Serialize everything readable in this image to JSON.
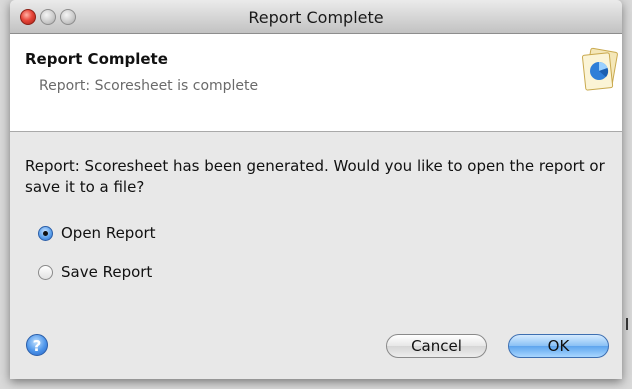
{
  "window": {
    "title": "Report Complete"
  },
  "header": {
    "title": "Report Complete",
    "subtitle": "Report: Scoresheet is complete",
    "icon": "report-document-icon"
  },
  "body": {
    "message": "Report: Scoresheet has been generated. Would you like to open the report or save it to a file?",
    "options": [
      {
        "label": "Open Report",
        "selected": true
      },
      {
        "label": "Save Report",
        "selected": false
      }
    ]
  },
  "footer": {
    "help_label": "?",
    "cancel_label": "Cancel",
    "ok_label": "OK"
  },
  "colors": {
    "accent": "#5ea5ee",
    "close": "#e8463a"
  }
}
